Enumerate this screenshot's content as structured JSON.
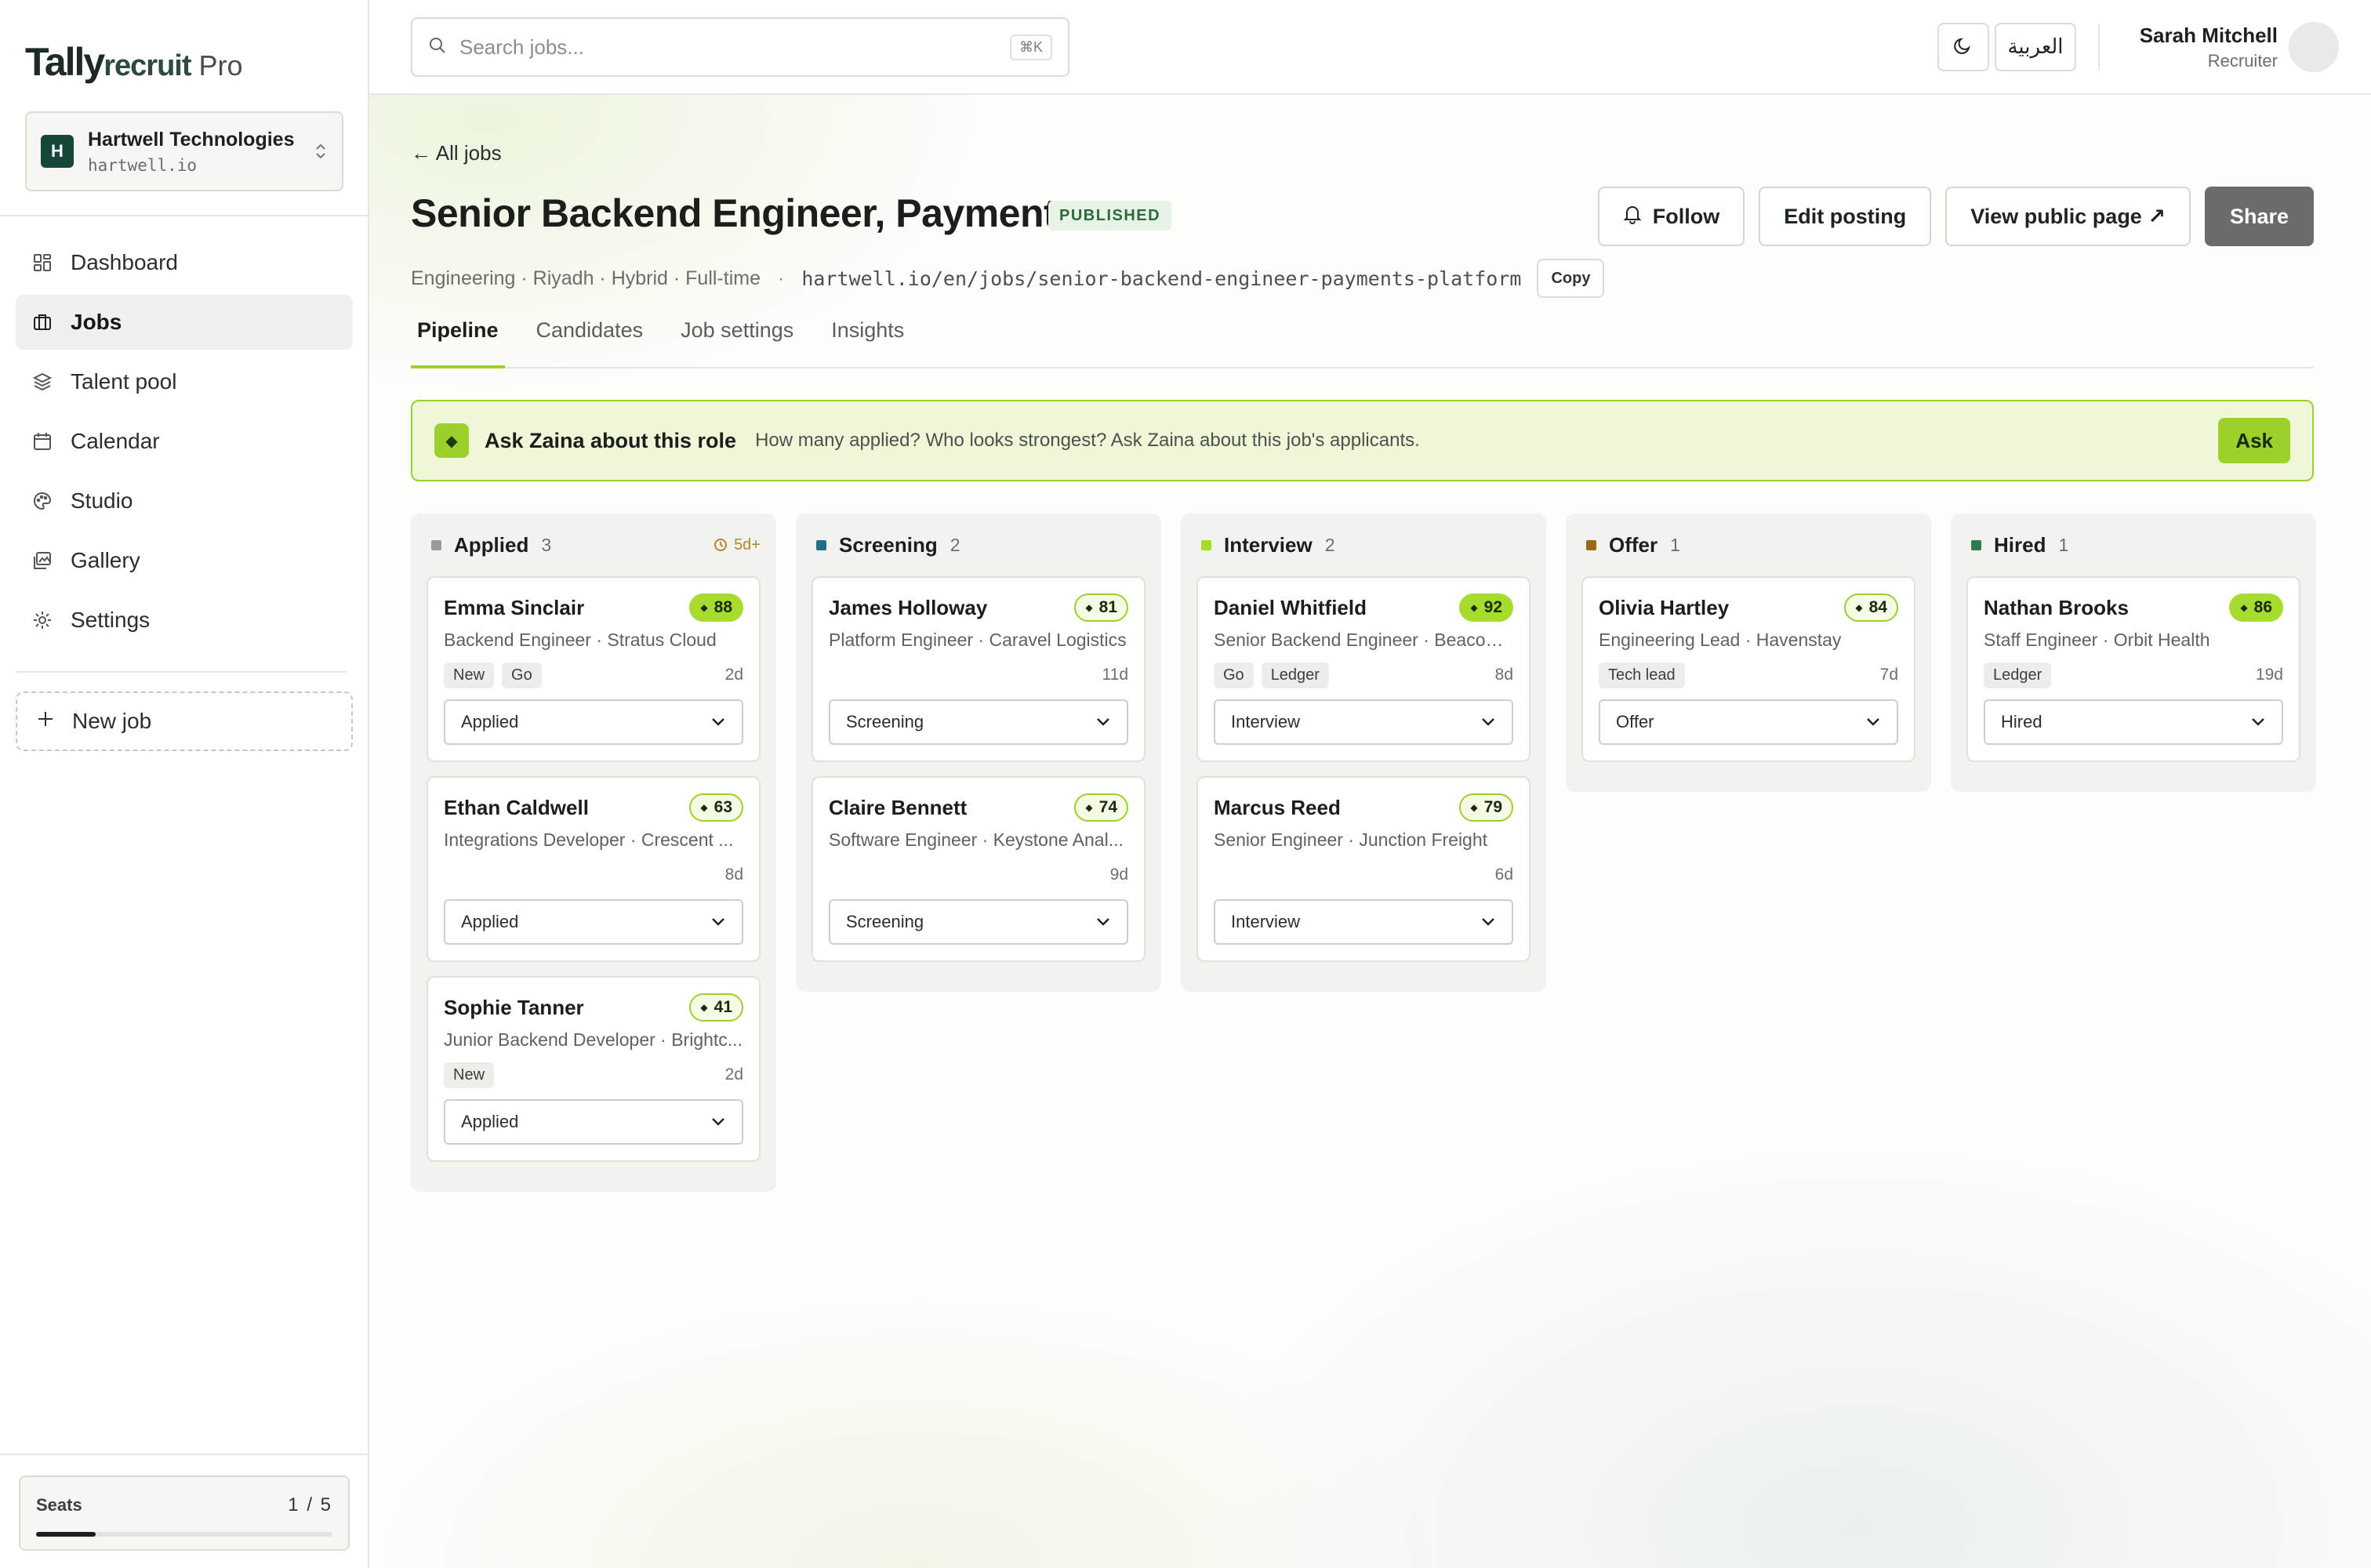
{
  "brand": {
    "part1": "Tally",
    "part2": "recruit",
    "part3": "Pro"
  },
  "org": {
    "initial": "H",
    "name": "Hartwell Technologies",
    "domain": "hartwell.io"
  },
  "nav": [
    {
      "label": "Dashboard",
      "icon": "dashboard-icon"
    },
    {
      "label": "Jobs",
      "icon": "briefcase-icon",
      "active": true
    },
    {
      "label": "Talent pool",
      "icon": "layers-icon"
    },
    {
      "label": "Calendar",
      "icon": "calendar-icon"
    },
    {
      "label": "Studio",
      "icon": "palette-icon"
    },
    {
      "label": "Gallery",
      "icon": "gallery-icon"
    },
    {
      "label": "Settings",
      "icon": "gear-icon"
    }
  ],
  "new_job": {
    "label": "New job"
  },
  "seats": {
    "label": "Seats",
    "value": "1 / 5",
    "fraction": 0.2
  },
  "search": {
    "placeholder": "Search jobs...",
    "shortcut": "⌘K"
  },
  "lang": {
    "label": "العربية"
  },
  "user": {
    "name": "Sarah Mitchell",
    "role": "Recruiter"
  },
  "job": {
    "back": "← All jobs",
    "title": "Senior Backend Engineer, Payments",
    "status": "PUBLISHED",
    "meta": "Engineering · Riyadh · Hybrid · Full-time",
    "sep": "·",
    "url": "hartwell.io/en/jobs/senior-backend-engineer-payments-platform",
    "copy": "Copy"
  },
  "actions": {
    "follow": "Follow",
    "edit": "Edit posting",
    "view": "View public page ↗",
    "share": "Share"
  },
  "tabs": [
    "Pipeline",
    "Candidates",
    "Job settings",
    "Insights"
  ],
  "ask": {
    "title": "Ask Zaina about this role",
    "desc": "How many applied? Who looks strongest? Ask Zaina about this job's applicants.",
    "button": "Ask"
  },
  "colors": {
    "accent": "#9bd12a",
    "applied": "#9a9a9a",
    "screening": "#1f6f8b",
    "interview": "#a6dc2e",
    "offer": "#9a6a1a",
    "hired": "#2f7a4a"
  },
  "columns": [
    {
      "name": "Applied",
      "count": "3",
      "age": "5d+",
      "cards": [
        {
          "name": "Emma Sinclair",
          "score": "88",
          "role": "Backend Engineer · Stratus Cloud",
          "tags": [
            "New",
            "Go"
          ],
          "age": "2d",
          "stage": "Applied"
        },
        {
          "name": "Ethan Caldwell",
          "score": "63",
          "role": "Integrations Developer · Crescent ...",
          "tags": [],
          "age": "8d",
          "stage": "Applied"
        },
        {
          "name": "Sophie Tanner",
          "score": "41",
          "role": "Junior Backend Developer · Brightc...",
          "tags": [
            "New"
          ],
          "age": "2d",
          "stage": "Applied"
        }
      ]
    },
    {
      "name": "Screening",
      "count": "2",
      "cards": [
        {
          "name": "James Holloway",
          "score": "81",
          "role": "Platform Engineer · Caravel Logistics",
          "tags": [],
          "age": "11d",
          "stage": "Screening"
        },
        {
          "name": "Claire Bennett",
          "score": "74",
          "role": "Software Engineer · Keystone Anal...",
          "tags": [],
          "age": "9d",
          "stage": "Screening"
        }
      ]
    },
    {
      "name": "Interview",
      "count": "2",
      "cards": [
        {
          "name": "Daniel Whitfield",
          "score": "92",
          "role": "Senior Backend Engineer · Beacon ...",
          "tags": [
            "Go",
            "Ledger"
          ],
          "age": "8d",
          "stage": "Interview"
        },
        {
          "name": "Marcus Reed",
          "score": "79",
          "role": "Senior Engineer · Junction Freight",
          "tags": [],
          "age": "6d",
          "stage": "Interview"
        }
      ]
    },
    {
      "name": "Offer",
      "count": "1",
      "cards": [
        {
          "name": "Olivia Hartley",
          "score": "84",
          "role": "Engineering Lead · Havenstay",
          "tags": [
            "Tech lead"
          ],
          "age": "7d",
          "stage": "Offer"
        }
      ]
    },
    {
      "name": "Hired",
      "count": "1",
      "cards": [
        {
          "name": "Nathan Brooks",
          "score": "86",
          "role": "Staff Engineer · Orbit Health",
          "tags": [
            "Ledger"
          ],
          "age": "19d",
          "stage": "Hired"
        }
      ]
    }
  ]
}
